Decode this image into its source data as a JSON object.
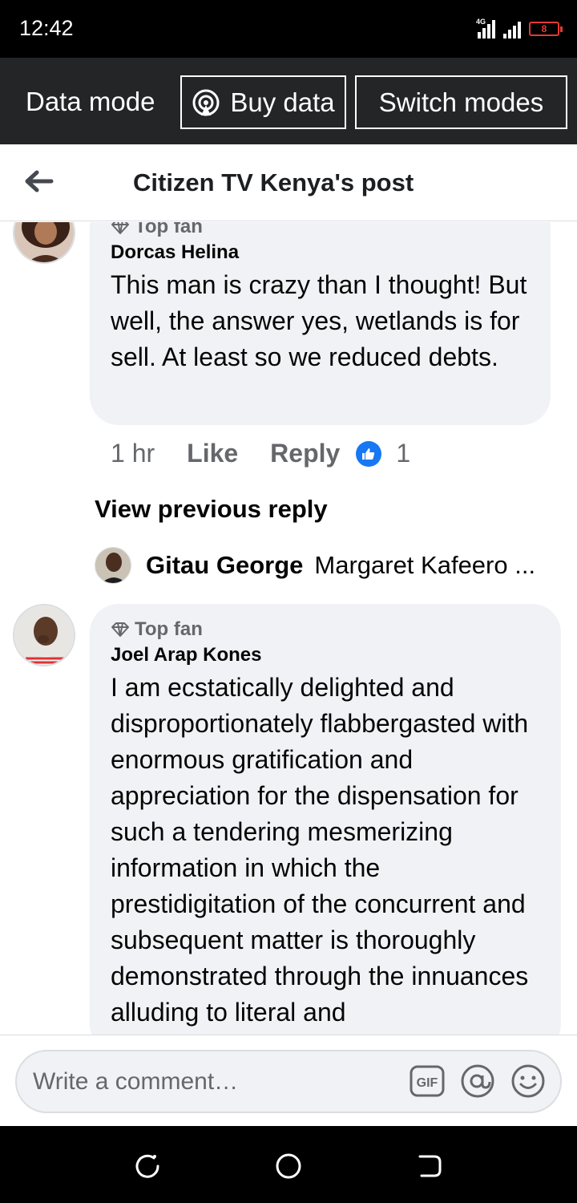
{
  "status_bar": {
    "time": "12:42",
    "network": "4G",
    "battery": "8"
  },
  "data_bar": {
    "mode_label": "Data mode",
    "buy_data_label": "Buy data",
    "switch_modes_label": "Switch modes"
  },
  "header": {
    "title": "Citizen TV Kenya's post"
  },
  "comments": [
    {
      "badge": "Top fan",
      "author": "Dorcas Helina",
      "text": "This man is crazy than I thought! But well,  the answer yes, wetlands is for sell. At least so we reduced debts.",
      "time": "1 hr",
      "like_label": "Like",
      "reply_label": "Reply",
      "reaction_count": "1"
    },
    {
      "badge": "Top fan",
      "author": "Joel Arap Kones",
      "text": "I am ecstatically delighted and disproportionately flabbergasted with enormous gratification and appreciation for the dispensation for such a tendering mesmerizing information in which the prestidigitation of the concurrent and subsequent matter is thoroughly demonstrated through the innuances alluding to literal and"
    }
  ],
  "view_previous_reply": "View previous reply",
  "reply_preview": {
    "author": "Gitau George",
    "snippet": "Margaret Kafeero ..."
  },
  "composer": {
    "placeholder": "Write a comment…",
    "gif_label": "GIF"
  },
  "colors": {
    "accent": "#1877f2",
    "bubble": "#f0f2f5",
    "secondary_text": "#65676b",
    "data_bar": "#242526",
    "battery_low": "#e53935"
  }
}
